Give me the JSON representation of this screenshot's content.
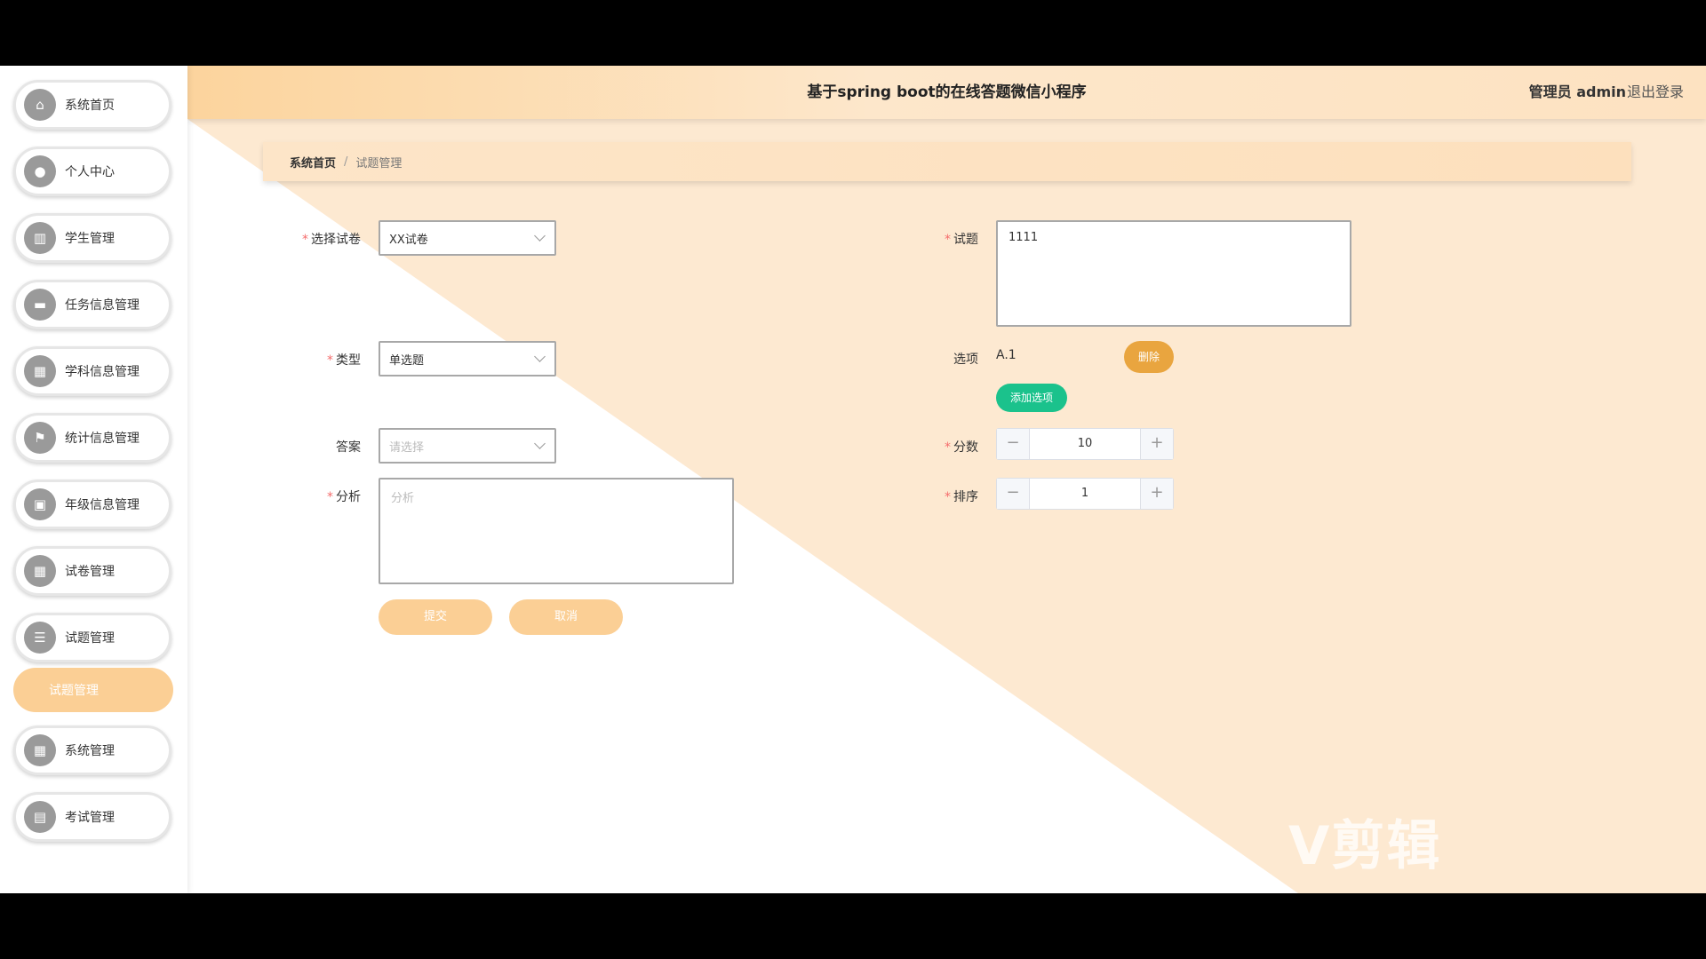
{
  "header": {
    "title": "基于spring boot的在线答题微信小程序",
    "admin": "管理员 admin",
    "logout": "退出登录"
  },
  "sidebar": {
    "items": [
      {
        "label": "系统首页"
      },
      {
        "label": "个人中心"
      },
      {
        "label": "学生管理"
      },
      {
        "label": "任务信息管理"
      },
      {
        "label": "学科信息管理"
      },
      {
        "label": "统计信息管理"
      },
      {
        "label": "年级信息管理"
      },
      {
        "label": "试卷管理"
      },
      {
        "label": "试题管理"
      },
      {
        "label": "系统管理"
      },
      {
        "label": "考试管理"
      }
    ],
    "submenu": "试题管理"
  },
  "breadcrumb": {
    "home": "系统首页",
    "sep": "/",
    "current": "试题管理"
  },
  "form": {
    "paper": {
      "label": "选择试卷",
      "value": "XX试卷"
    },
    "type": {
      "label": "类型",
      "value": "单选题"
    },
    "answer": {
      "label": "答案",
      "placeholder": "请选择"
    },
    "analysis": {
      "label": "分析",
      "placeholder": "分析"
    },
    "question": {
      "label": "试题",
      "value": "1111"
    },
    "options": {
      "label": "选项",
      "item": "A.1",
      "delete": "删除",
      "add": "添加选项"
    },
    "score": {
      "label": "分数",
      "value": "10",
      "minus": "−",
      "plus": "+"
    },
    "order": {
      "label": "排序",
      "value": "1",
      "minus": "−",
      "plus": "+"
    },
    "submit": "提交",
    "cancel": "取消"
  },
  "watermark": "V剪辑",
  "colors": {
    "accent": "#fbcf95",
    "green": "#1bc28c",
    "orange": "#e9a53f"
  }
}
